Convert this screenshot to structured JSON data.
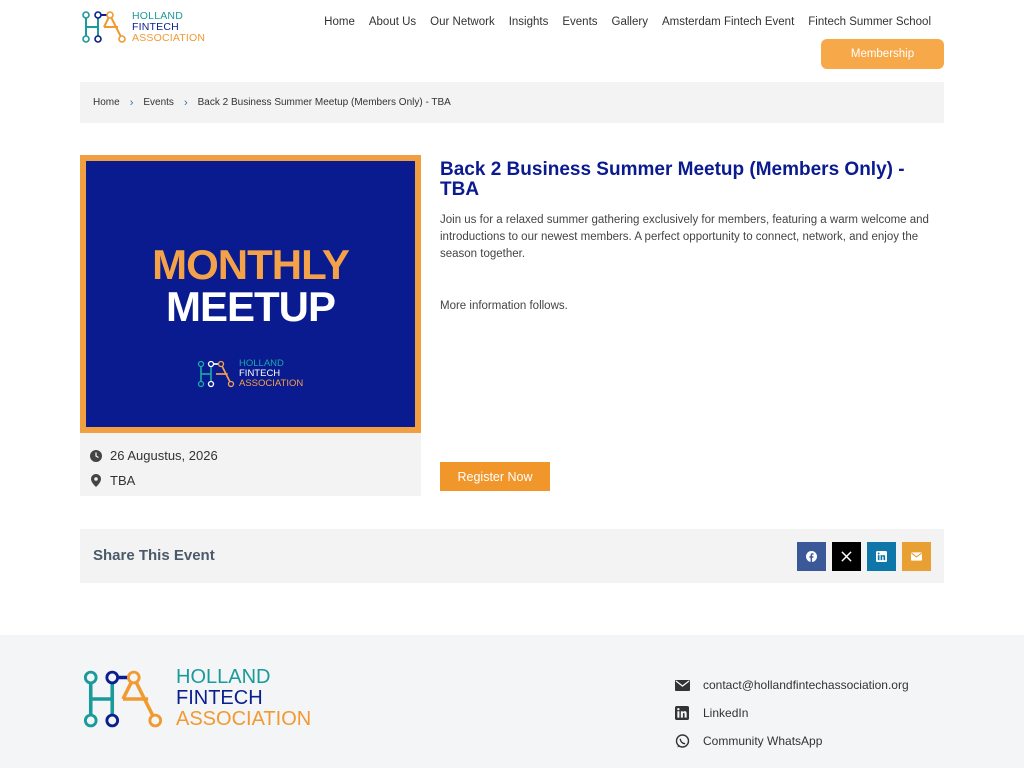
{
  "header": {
    "logo": {
      "line1": "HOLLAND",
      "line2": "FINTECH",
      "line3": "ASSOCIATION"
    },
    "nav": [
      "Home",
      "About Us",
      "Our Network",
      "Insights",
      "Events",
      "Gallery",
      "Amsterdam Fintech Event",
      "Fintech Summer School"
    ],
    "membership_label": "Membership"
  },
  "breadcrumb": [
    "Home",
    "Events",
    "Back 2 Business Summer Meetup (Members Only) - TBA"
  ],
  "event": {
    "image": {
      "line1": "MONTHLY",
      "line2": "MEETUP",
      "logo": {
        "line1": "HOLLAND",
        "line2": "FINTECH",
        "line3": "ASSOCIATION"
      }
    },
    "date": "26 Augustus, 2026",
    "location": "TBA",
    "title": "Back 2 Business Summer Meetup (Members Only) - TBA",
    "description": "Join us for a relaxed summer gathering exclusively for members, featuring a warm welcome and introductions to our newest members. A perfect opportunity to connect, network, and enjoy the season together.",
    "more_info": "More information follows.",
    "register_label": "Register Now"
  },
  "share": {
    "title": "Share This Event",
    "buttons": [
      {
        "icon": "facebook-icon",
        "color": "#3b5998"
      },
      {
        "icon": "x-icon",
        "color": "#000000"
      },
      {
        "icon": "linkedin-icon",
        "color": "#0e76a8"
      },
      {
        "icon": "email-icon",
        "color": "#e8a033"
      }
    ]
  },
  "footer": {
    "logo": {
      "line1": "HOLLAND",
      "line2": "FINTECH",
      "line3": "ASSOCIATION"
    },
    "email": "contact@hollandfintechassociation.org",
    "linkedin": "LinkedIn",
    "whatsapp": "Community WhatsApp"
  },
  "colors": {
    "brand_blue": "#0a1a8f",
    "brand_orange": "#f0962a",
    "brand_teal": "#1a9a9a"
  }
}
